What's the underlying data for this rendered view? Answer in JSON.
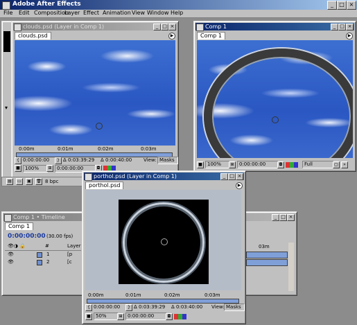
{
  "app": {
    "title": "Adobe After Effects",
    "min": "_",
    "max": "□",
    "close": "×"
  },
  "menu": [
    "File",
    "Edit",
    "Composition",
    "Layer",
    "Effect",
    "Animation",
    "View",
    "Window",
    "Help"
  ],
  "clouds_window": {
    "title": "clouds.psd (Layer in Comp 1)",
    "tab": "clouds.psd",
    "ruler": [
      "0:00m",
      "0:01m",
      "0:02m",
      "0:03m"
    ],
    "time_start": "0:00:00:00",
    "time_duration": "Δ 0:03:39:29",
    "time_end": "Δ 0:00:40:00",
    "view_label": "View:",
    "view_value": "Masks",
    "zoom": "100%",
    "current_time": "0:00:00:00",
    "bottom_depth": "8 bpc"
  },
  "comp_window": {
    "title": "Comp 1",
    "tab": "Comp 1",
    "zoom": "100%",
    "current_time": "0:00:00:00",
    "resolution": "Full"
  },
  "porthole_window": {
    "title": "porthol.psd (Layer in Comp 1)",
    "tab": "porthol.psd",
    "ruler": [
      "0:00m",
      "0:01m",
      "0:02m",
      "0:03m"
    ],
    "time_start": "0:00:00:00",
    "time_duration": "Δ 0:03:39:29",
    "time_end": "Δ 0:03:40:00",
    "view_label": "View:",
    "view_value": "Masks",
    "zoom": "50%",
    "current_time": "0:00:00:00"
  },
  "timeline": {
    "title": "Comp 1 • Timeline",
    "tab": "Comp 1",
    "current_time": "0:00:00:00",
    "fps": "(30.00 fps)",
    "col_num": "#",
    "col_layer": "Layer",
    "col_right": "03m",
    "rows": [
      {
        "num": "1",
        "name": "[p"
      },
      {
        "num": "2",
        "name": "[c"
      }
    ]
  },
  "colors": {
    "desktop": "#8c8c8c",
    "chrome": "#c0c0c0",
    "title_active": "#0a246a",
    "sky": "#2a57c2",
    "work_area": "#7f9fd8"
  }
}
